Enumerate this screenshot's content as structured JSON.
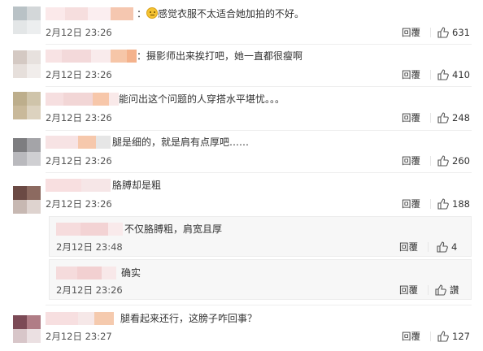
{
  "comments": [
    {
      "text": "感觉衣服不太适合她加拍的不好。",
      "prefix": "：",
      "date": "2月12日 23:26",
      "reply": "回覆",
      "likes": "631"
    },
    {
      "text": "摄影师出来挨打吧，她一直都很瘦啊",
      "prefix": "：",
      "date": "2月12日 23:26",
      "reply": "回覆",
      "likes": "410"
    },
    {
      "text": "能问出这个问题的人穿搭水平堪忧。。。",
      "date": "2月12日 23:26",
      "reply": "回覆",
      "likes": "248"
    },
    {
      "text": "腿是细的，就是肩有点厚吧……",
      "date": "2月12日 23:26",
      "reply": "回覆",
      "likes": "260"
    },
    {
      "text": "胳膊却是粗",
      "date": "2月12日 23:26",
      "reply": "回覆",
      "likes": "188"
    },
    {
      "text": "腿看起来还行，这膀子咋回事？",
      "date": "2月12日 23:27",
      "reply": "回覆",
      "likes": "127"
    }
  ],
  "subreplies": [
    {
      "text": "不仅胳膊粗，肩宽且厚",
      "date": "2月12日 23:48",
      "reply": "回覆",
      "likes": "4"
    },
    {
      "text": "确实",
      "date": "2月12日 23:26",
      "reply": "回覆",
      "likes": "讚"
    }
  ],
  "colors": {
    "text": "#333333",
    "meta": "#555555",
    "divider": "#eeeeee"
  },
  "icons": {
    "like": "thumbs-up-icon",
    "emoji": "smiley-emoji-icon"
  }
}
